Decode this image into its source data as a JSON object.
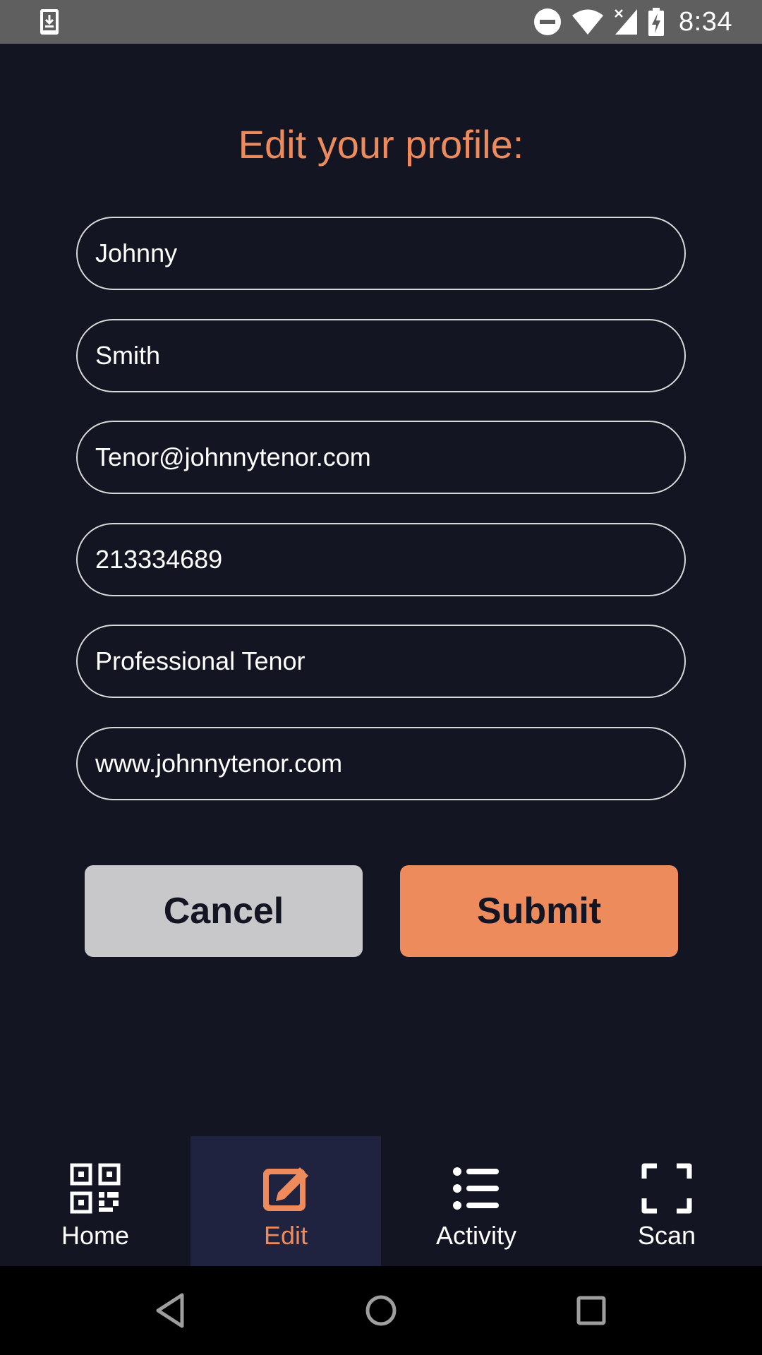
{
  "status_bar": {
    "time": "8:34",
    "icons": [
      "download-notification-icon",
      "do-not-disturb-icon",
      "wifi-icon",
      "cell-signal-icon",
      "battery-charging-icon"
    ]
  },
  "page": {
    "title": "Edit your profile:"
  },
  "form": {
    "first_name": "Johnny",
    "last_name": "Smith",
    "email": "Tenor@johnnytenor.com",
    "phone": "213334689",
    "occupation": "Professional Tenor",
    "website": "www.johnnytenor.com"
  },
  "buttons": {
    "cancel": "Cancel",
    "submit": "Submit"
  },
  "nav": {
    "items": [
      {
        "label": "Home",
        "icon": "qr-code-icon"
      },
      {
        "label": "Edit",
        "icon": "edit-icon",
        "active": true
      },
      {
        "label": "Activity",
        "icon": "list-icon"
      },
      {
        "label": "Scan",
        "icon": "scan-frame-icon"
      }
    ]
  },
  "colors": {
    "background": "#131522",
    "accent": "#ee8b5d",
    "active_tab_background": "#1f2340",
    "cancel_button": "#c8c8ca",
    "status_bar": "#5f5f5f"
  }
}
